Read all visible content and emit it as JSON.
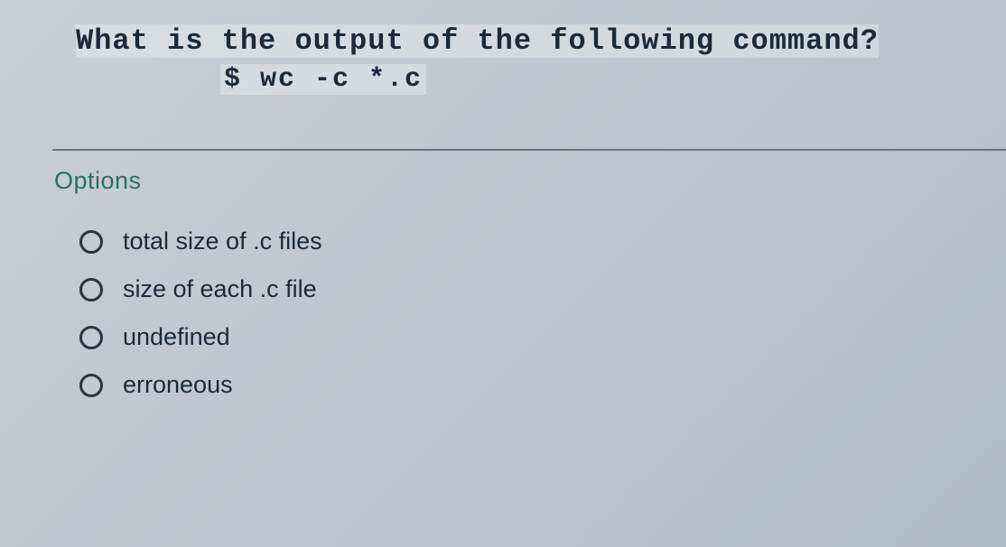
{
  "question": {
    "prompt": "What is the output of the following command?",
    "command": "$ wc  -c  *.c"
  },
  "options_heading": "Options",
  "options": [
    {
      "label": "total size of .c files"
    },
    {
      "label": "size of each .c file"
    },
    {
      "label": "undefined"
    },
    {
      "label": "erroneous"
    }
  ]
}
